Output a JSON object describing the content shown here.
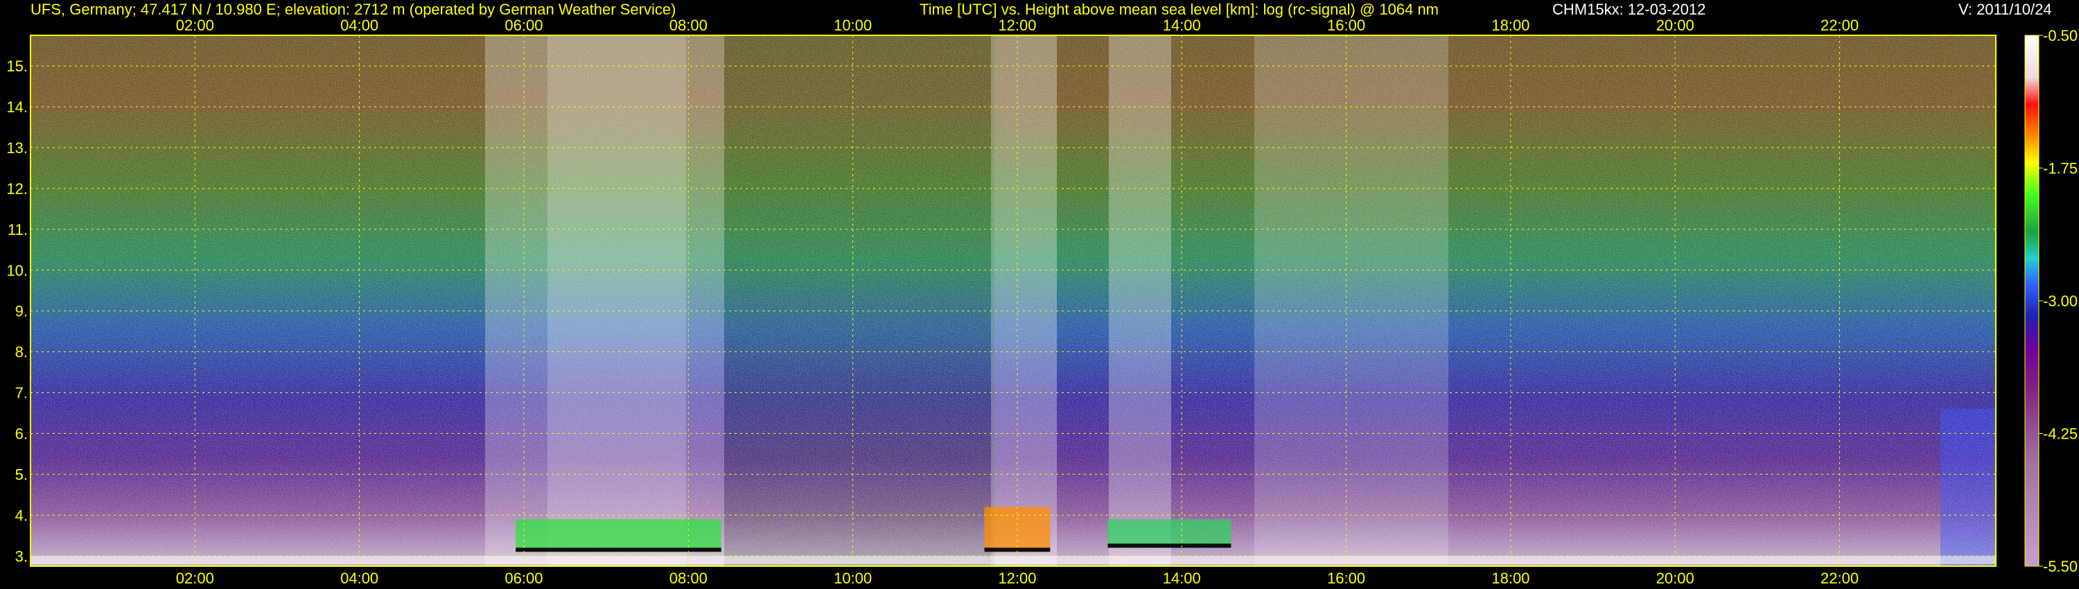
{
  "header": {
    "site": "UFS, Germany; 47.417 N / 10.980 E; elevation: 2712 m  (operated by German Weather Service)",
    "title": "Time [UTC] vs. Height above mean sea level [km]: log (rc-signal) @ 1064 nm",
    "instrument": "CHM15kx: 12-03-2012",
    "version": "V: 2011/10/24"
  },
  "chart_data": {
    "type": "heatmap",
    "title": "Time [UTC] vs. Height above mean sea level [km]: log (rc-signal) @ 1064 nm",
    "xlabel": "Time [UTC]",
    "ylabel": "Height above mean sea level [km]",
    "x_ticks": [
      "02:00",
      "04:00",
      "06:00",
      "08:00",
      "10:00",
      "12:00",
      "14:00",
      "16:00",
      "18:00",
      "20:00",
      "22:00"
    ],
    "x_tick_hours": [
      2,
      4,
      6,
      8,
      10,
      12,
      14,
      16,
      18,
      20,
      22
    ],
    "xlim_hours": [
      0,
      23.9
    ],
    "y_ticks": [
      "3.",
      "4.",
      "5.",
      "6.",
      "7.",
      "8.",
      "9.",
      "10.",
      "11.",
      "12.",
      "13.",
      "14.",
      "15."
    ],
    "y_tick_values": [
      3,
      4,
      5,
      6,
      7,
      8,
      9,
      10,
      11,
      12,
      13,
      14,
      15
    ],
    "ylim": [
      2.75,
      15.75
    ],
    "grid": true,
    "colorbar": {
      "labels": [
        "-0.50",
        "-1.75",
        "-3.00",
        "-4.25",
        "-5.50"
      ],
      "values": [
        -0.5,
        -1.75,
        -3.0,
        -4.25,
        -5.5
      ],
      "range": [
        -5.5,
        -0.5
      ]
    },
    "features": [
      {
        "name": "aerosol/ground layer",
        "start_h": 0,
        "end_h": 23.9,
        "bottom_km": 2.8,
        "top_km": 3.0
      },
      {
        "name": "cloud layer",
        "start_h": 5.9,
        "end_h": 8.4,
        "bottom_km": 3.1,
        "top_km": 3.9
      },
      {
        "name": "cloud layer",
        "start_h": 11.6,
        "end_h": 12.4,
        "bottom_km": 3.1,
        "top_km": 4.2
      },
      {
        "name": "cloud layer",
        "start_h": 13.1,
        "end_h": 14.6,
        "bottom_km": 3.2,
        "top_km": 3.9
      }
    ]
  }
}
